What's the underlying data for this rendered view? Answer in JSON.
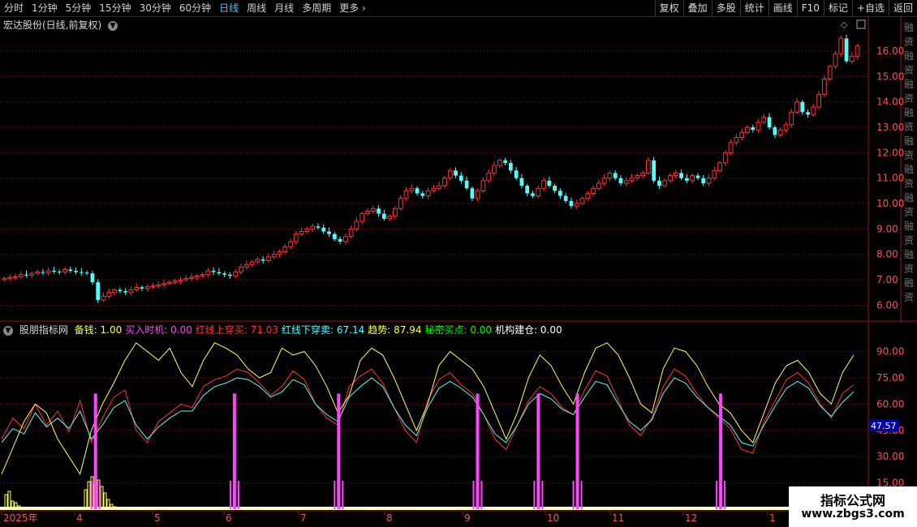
{
  "toolbar": {
    "timeframes": [
      {
        "label": "分时",
        "active": false
      },
      {
        "label": "1分钟",
        "active": false
      },
      {
        "label": "5分钟",
        "active": false
      },
      {
        "label": "15分钟",
        "active": false
      },
      {
        "label": "30分钟",
        "active": false
      },
      {
        "label": "60分钟",
        "active": false
      },
      {
        "label": "日线",
        "active": true
      },
      {
        "label": "周线",
        "active": false
      },
      {
        "label": "月线",
        "active": false
      },
      {
        "label": "多周期",
        "active": false
      },
      {
        "label": "更多",
        "active": false
      }
    ],
    "right_buttons": [
      "复权",
      "叠加",
      "多股",
      "统计",
      "画线",
      "F10",
      "标记",
      "+自选",
      "返回"
    ]
  },
  "main_chart": {
    "title": "宏达股份(日线,前复权)",
    "price_ticks": [
      "16.00",
      "15.00",
      "14.00",
      "13.00",
      "12.00",
      "11.00",
      "10.00",
      "9.00",
      "8.00",
      "7.00",
      "6.00"
    ],
    "up_color": "#ff3232",
    "down_color": "#54fcfc",
    "right_panel_text": [
      "融",
      "资",
      "融",
      "资",
      "融",
      "资",
      "融",
      "资",
      "融",
      "资",
      "融",
      "资",
      "融",
      "资",
      "融",
      "资",
      "融",
      "资",
      "融",
      "资"
    ]
  },
  "indicator": {
    "name": "股朋指标网",
    "fields": [
      {
        "label": "备钱:",
        "value": "1.00",
        "color": "#ffff55"
      },
      {
        "label": "买入时机:",
        "value": "0.00",
        "color": "#ff44ff"
      },
      {
        "label": "红线上穿买:",
        "value": "71.03",
        "color": "#ff3232"
      },
      {
        "label": "红线下穿卖:",
        "value": "67.14",
        "color": "#54fcfc"
      },
      {
        "label": "趋势:",
        "value": "87.94",
        "color": "#ffff55"
      },
      {
        "label": "秘密买点:",
        "value": "0.00",
        "color": "#00ff00"
      },
      {
        "label": "机构建仓:",
        "value": "0.00",
        "color": "#ffffff"
      }
    ],
    "ticks": [
      "90.00",
      "75.00",
      "60.00",
      "45.00",
      "30.00",
      "15.00"
    ],
    "current_badge": "47.57"
  },
  "x_axis": {
    "labels": [
      "2025年",
      "4",
      "5",
      "6",
      "7",
      "8",
      "9",
      "10",
      "11",
      "12",
      "1"
    ]
  },
  "watermark": {
    "line1": "指标公式网",
    "line2": "www.zbgs3.com"
  },
  "chart_data": [
    {
      "type": "candlestick",
      "title": "宏达股份(日线,前复权)",
      "ylim": [
        5.5,
        16.8
      ],
      "closes": [
        7.05,
        7.1,
        7.12,
        7.2,
        7.18,
        7.25,
        7.3,
        7.28,
        7.35,
        7.32,
        7.3,
        7.4,
        7.35,
        7.3,
        7.28,
        7.25,
        6.9,
        6.2,
        6.35,
        6.5,
        6.6,
        6.55,
        6.5,
        6.6,
        6.7,
        6.65,
        6.72,
        6.75,
        6.8,
        6.85,
        6.9,
        6.95,
        7.0,
        7.05,
        7.1,
        7.15,
        7.2,
        7.35,
        7.3,
        7.25,
        7.2,
        7.15,
        7.3,
        7.5,
        7.6,
        7.7,
        7.8,
        7.75,
        7.9,
        8.0,
        8.1,
        8.3,
        8.5,
        8.8,
        8.9,
        9.0,
        9.1,
        9.05,
        8.9,
        8.8,
        8.6,
        8.5,
        8.7,
        9.0,
        9.3,
        9.6,
        9.7,
        9.8,
        9.6,
        9.4,
        9.5,
        9.8,
        10.2,
        10.5,
        10.6,
        10.4,
        10.3,
        10.5,
        10.6,
        10.7,
        11.0,
        11.3,
        11.1,
        10.9,
        10.6,
        10.2,
        10.5,
        10.9,
        11.2,
        11.5,
        11.7,
        11.6,
        11.3,
        11.0,
        10.7,
        10.4,
        10.3,
        10.6,
        10.9,
        10.7,
        10.5,
        10.3,
        10.1,
        9.9,
        10.0,
        10.2,
        10.4,
        10.6,
        10.8,
        11.0,
        11.2,
        11.0,
        10.8,
        10.9,
        11.0,
        11.1,
        11.2,
        11.7,
        10.9,
        10.7,
        10.9,
        11.1,
        11.2,
        11.0,
        10.9,
        11.1,
        11.0,
        10.8,
        11.0,
        11.3,
        11.6,
        12.0,
        12.4,
        12.6,
        12.8,
        13.0,
        12.9,
        13.2,
        13.4,
        13.0,
        12.7,
        12.9,
        13.1,
        13.6,
        14.0,
        13.6,
        13.5,
        13.8,
        14.3,
        14.9,
        15.4,
        15.9,
        16.5,
        15.6,
        15.8,
        16.2
      ]
    },
    {
      "type": "line",
      "title": "股朋指标网",
      "ylim": [
        0,
        100
      ],
      "series": [
        {
          "name": "红线上穿买",
          "color": "#ff3232",
          "values": [
            40,
            52,
            46,
            60,
            48,
            56,
            44,
            62,
            38,
            52,
            64,
            68,
            45,
            38,
            50,
            55,
            60,
            58,
            70,
            74,
            76,
            80,
            78,
            72,
            65,
            70,
            79,
            74,
            60,
            52,
            48,
            70,
            76,
            80,
            72,
            58,
            45,
            38,
            62,
            74,
            78,
            71,
            66,
            54,
            40,
            34,
            48,
            62,
            70,
            66,
            58,
            54,
            68,
            79,
            76,
            62,
            48,
            42,
            52,
            70,
            80,
            76,
            66,
            58,
            52,
            46,
            34,
            32,
            50,
            62,
            74,
            78,
            72,
            60,
            52,
            66,
            71
          ]
        },
        {
          "name": "红线下穿卖",
          "color": "#54fcfc",
          "values": [
            38,
            46,
            43,
            55,
            47,
            52,
            46,
            56,
            40,
            48,
            58,
            62,
            48,
            40,
            47,
            52,
            56,
            56,
            65,
            70,
            72,
            75,
            74,
            70,
            64,
            67,
            74,
            71,
            60,
            54,
            50,
            64,
            70,
            75,
            70,
            58,
            48,
            42,
            58,
            69,
            73,
            69,
            64,
            54,
            43,
            38,
            48,
            60,
            66,
            63,
            57,
            54,
            64,
            73,
            71,
            60,
            50,
            45,
            51,
            66,
            75,
            72,
            64,
            58,
            53,
            48,
            38,
            36,
            48,
            59,
            69,
            73,
            69,
            59,
            53,
            61,
            67
          ]
        },
        {
          "name": "趋势",
          "color": "#ffff55",
          "values": [
            20,
            35,
            50,
            60,
            55,
            40,
            30,
            20,
            45,
            60,
            72,
            85,
            95,
            90,
            85,
            92,
            78,
            70,
            85,
            95,
            92,
            88,
            80,
            75,
            78,
            92,
            88,
            90,
            82,
            70,
            55,
            65,
            85,
            92,
            88,
            75,
            60,
            45,
            60,
            82,
            90,
            85,
            80,
            70,
            55,
            40,
            55,
            75,
            88,
            82,
            70,
            60,
            78,
            92,
            95,
            88,
            75,
            60,
            55,
            80,
            92,
            90,
            82,
            70,
            60,
            55,
            45,
            38,
            55,
            72,
            82,
            85,
            78,
            66,
            60,
            78,
            88
          ]
        },
        {
          "name": "买入时机",
          "color": "#ff44ff",
          "signals_x": [
            0.11,
            0.27,
            0.39,
            0.55,
            0.62,
            0.665,
            0.83
          ]
        }
      ],
      "ticks": [
        90,
        75,
        60,
        45,
        30,
        15
      ]
    }
  ]
}
